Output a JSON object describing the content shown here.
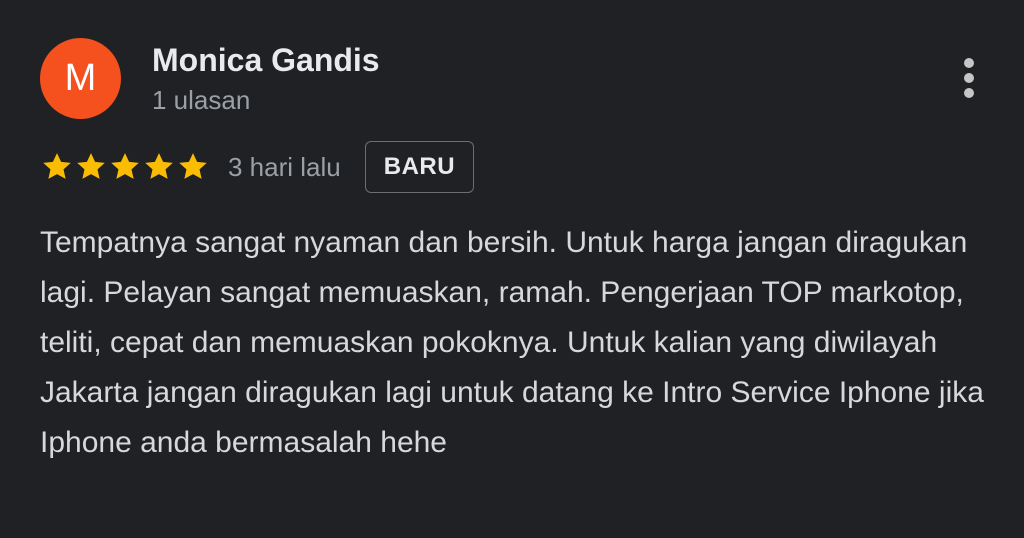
{
  "review": {
    "avatar_initial": "M",
    "avatar_color": "#f4511e",
    "author": "Monica Gandis",
    "author_meta": "1 ulasan",
    "rating": 5,
    "rating_max": 5,
    "date": "3 hari lalu",
    "badge": "BARU",
    "text": "Tempatnya sangat nyaman dan bersih. Untuk harga jangan diragukan lagi. Pelayan sangat memuaskan, ramah. Pengerjaan TOP markotop, teliti, cepat dan memuaskan pokoknya. Untuk kalian yang diwilayah Jakarta jangan diragukan lagi untuk datang ke Intro Service Iphone jika Iphone anda bermasalah hehe",
    "star_color": "#fbbc04",
    "more_icon": "more-vert-icon"
  }
}
